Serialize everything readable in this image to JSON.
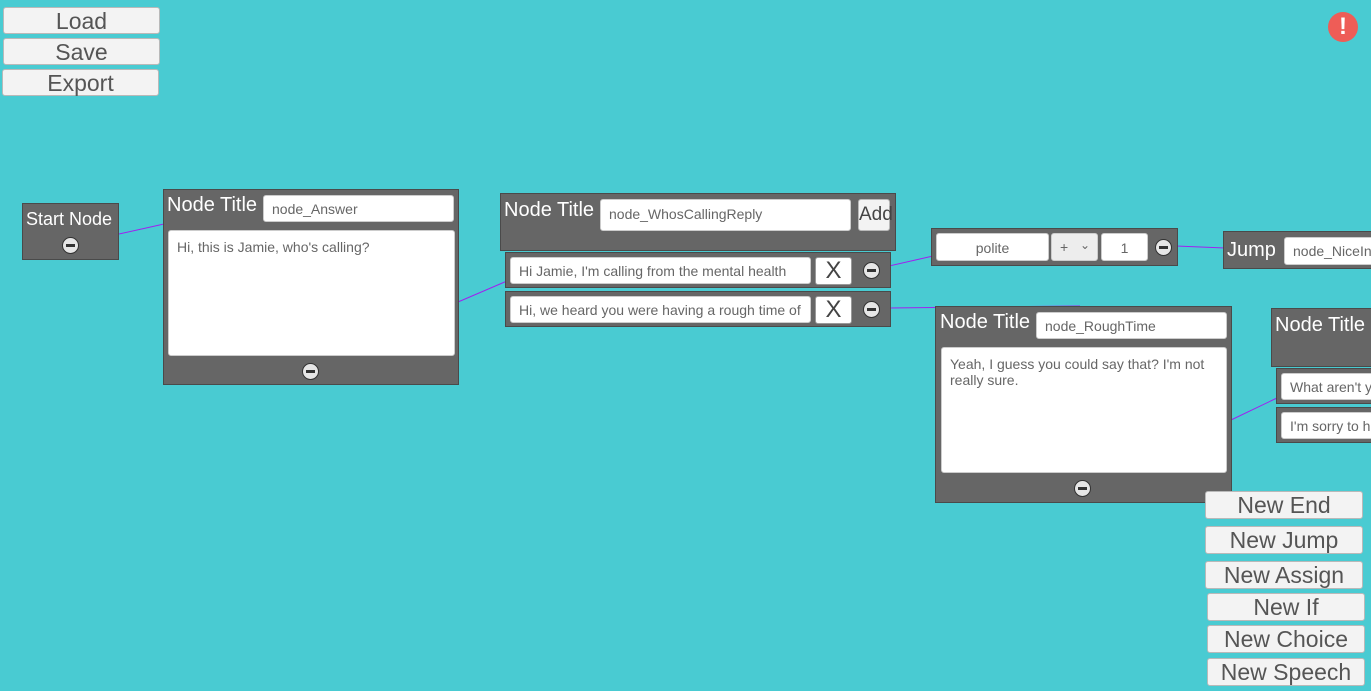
{
  "toolbar": {
    "load": "Load",
    "save": "Save",
    "export": "Export"
  },
  "alert": {
    "symbol": "!"
  },
  "start_node": {
    "label": "Start Node"
  },
  "node_answer": {
    "title_label": "Node Title",
    "title_value": "node_Answer",
    "speech": "Hi, this is Jamie, who's calling?"
  },
  "node_whos_calling": {
    "title_label": "Node Title",
    "title_value": "node_WhosCallingReply",
    "add_label": "Add",
    "choices": [
      {
        "text": "Hi Jamie, I'm calling from the mental health",
        "remove": "X"
      },
      {
        "text": "Hi, we heard you were having a rough time of",
        "remove": "X"
      }
    ]
  },
  "assign_node": {
    "variable": "polite",
    "operator": "+",
    "value": "1"
  },
  "jump_node": {
    "label": "Jump",
    "target": "node_NiceIn"
  },
  "node_rough_time": {
    "title_label": "Node Title",
    "title_value": "node_RoughTime",
    "speech": "Yeah, I guess you could say that? I'm not really sure."
  },
  "node_right": {
    "title_label": "Node Title",
    "choices": [
      "What aren't y",
      "I'm sorry to h"
    ]
  },
  "sidebar": {
    "new_end": "New End",
    "new_jump": "New Jump",
    "new_assign": "New Assign",
    "new_if": "New If",
    "new_choice": "New Choice",
    "new_speech": "New Speech"
  },
  "colors": {
    "background": "#49CBD2",
    "node": "#666666",
    "wire": "#A020F0",
    "alert": "#EE5D57"
  }
}
